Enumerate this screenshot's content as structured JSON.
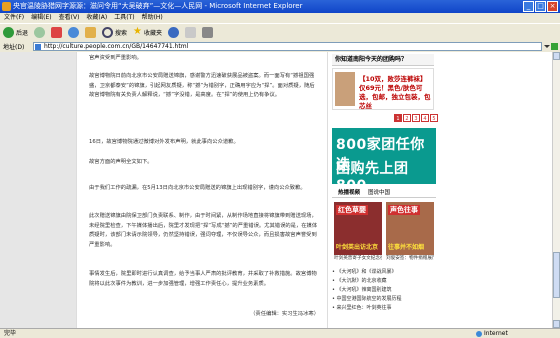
{
  "window": {
    "title": "央官温陵胁猎网字源源：滋问令用“大吴破弃”—文化—人民网 - Microsoft Internet Explorer"
  },
  "menu": [
    "文件(F)",
    "编辑(E)",
    "查看(V)",
    "收藏(A)",
    "工具(T)",
    "帮助(H)"
  ],
  "toolbar": {
    "back": "后退",
    "search": "搜索",
    "favorites": "收藏夹"
  },
  "address": {
    "label": "地址(D)",
    "url": "http://culture.people.com.cn/GB/14647741.html"
  },
  "article": {
    "paragraphs": [
      "官声资受到严重影响。",
      "故宫博物院日前向北京市公安局赠送锦旗，感谢警方迅速破获展品被盗案。而一面写有“撼祖国强盛，卫京都泰安”的锦旗，引起网友质疑，称“撼”为错别字，正确用字应为“捍”。面对质疑，随后故宫博物院有关负责人解释说，“撼”字没错，是高度。在“捍”的使用上仍有争议。",
      "16日，故宫博物院通过微博对外发布声明，就此事向公众道歉。",
      "故宫方面的声明全文如下。",
      "由于我们工作的疏漏，在5月13日向北京市公安局赠送的锦旗上出现错别字，谨向公众致歉。",
      "此次赠送锦旗由院保卫部门负责联系、制作，由于时间紧，从制作场地直接将锦旗带到赠送现场，未经院里检查，下午媒体播出后，院里才发现把“捍”写成“撼”的严重错误。尤其错误的是，在媒体质疑时，该部门未请示院领导，仍然坚持错误，强词夺理，不仅误导公众，而且损害故宫声誉受到严重影响。",
      "事情发生后，院里即时进行认真调查，给予当事人严肃的批评教育，并采取了补救措施。故宫博物院将以此次事件为教训，进一步加强管理，增强工作责任心，提升业务素质。",
      "（责任编辑：实习生冯冰寒）"
    ]
  },
  "sidebar": {
    "title": "你知道南阳今天的团购吗？",
    "promo": "【10双，败莎连裤袜】仅69元！黑色/肤色可选，包邮，独立包装，包芯丝",
    "pager": [
      "1",
      "2",
      "3",
      "4",
      "5"
    ],
    "pager_active": "1",
    "banner_line1": "800家团任你选",
    "banner_line2": "团购先上团800",
    "tabs": [
      "热播视频",
      "图说中国"
    ],
    "thumb1": {
      "label": "红色草婴",
      "subtitle": "叶剑英出访北京",
      "caption": "叶剑英曾寄子女文纪念往子"
    },
    "thumb2": {
      "label": "声色往事",
      "subtitle": "往事并不如烟",
      "caption": "刘俊安签：物件捐赠展厅"
    },
    "news": [
      "• 《大河吼》和《谍战风暴》",
      "• 《大沉默》的北京收藏",
      "• 《大河吼》辣离国别建筑",
      "• 中国空港国际航空的发展历程",
      "• 来兴里红色：叶剑英往事"
    ]
  },
  "status": {
    "left": "完毕",
    "zone": "Internet"
  },
  "colors": {
    "titlebar": "#1045c8",
    "chrome": "#ece9d8",
    "banner": "#0a9a8f",
    "accent_red": "#cc3333"
  }
}
